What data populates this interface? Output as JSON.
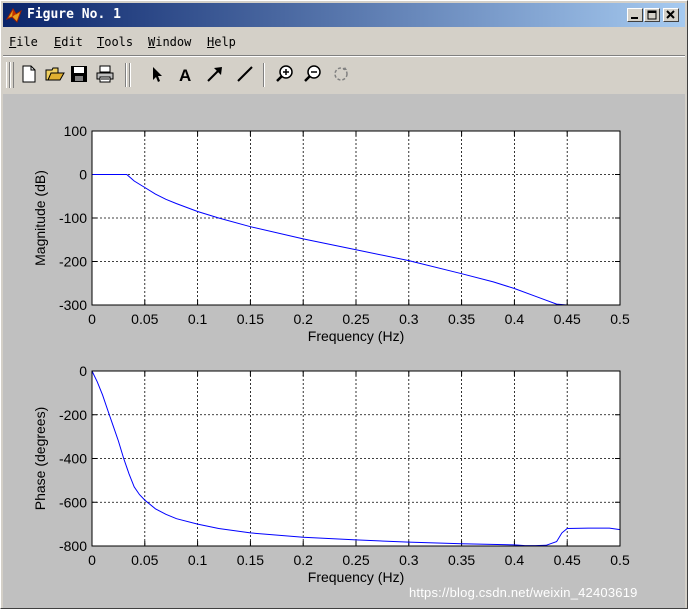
{
  "window": {
    "title": "Figure No. 1"
  },
  "menu": [
    {
      "key": "F",
      "rest": "ile"
    },
    {
      "key": "E",
      "rest": "dit"
    },
    {
      "key": "T",
      "rest": "ools"
    },
    {
      "key": "W",
      "rest": "indow"
    },
    {
      "key": "H",
      "rest": "elp"
    }
  ],
  "toolbar": {
    "icons": [
      "new-file-icon",
      "open-file-icon",
      "save-icon",
      "print-icon",
      "select-arrow-icon",
      "text-icon",
      "arrow-icon",
      "line-icon",
      "zoom-in-icon",
      "zoom-out-icon",
      "rotate-icon"
    ],
    "text_tool_label": "A"
  },
  "colors": {
    "line": "#0000ff",
    "axes_bg": "#ffffff",
    "figure_bg": "#c0c0c0",
    "titlebar_start": "#0a246a",
    "titlebar_end": "#a6caf0"
  },
  "watermark": "https://blog.csdn.net/weixin_42403619",
  "chart_data": [
    {
      "type": "line",
      "title": "",
      "xlabel": "Frequency (Hz)",
      "ylabel": "Magnitude (dB)",
      "xlim": [
        0,
        0.5
      ],
      "ylim": [
        -300,
        100
      ],
      "grid": true,
      "xticks": [
        "0",
        "0.05",
        "0.1",
        "0.15",
        "0.2",
        "0.25",
        "0.3",
        "0.35",
        "0.4",
        "0.45",
        "0.5"
      ],
      "yticks": [
        "-300",
        "-200",
        "-100",
        "0",
        "100"
      ],
      "series": [
        {
          "x": [
            0,
            0.01,
            0.02,
            0.033,
            0.04,
            0.05,
            0.06,
            0.07,
            0.08,
            0.1,
            0.12,
            0.15,
            0.2,
            0.25,
            0.3,
            0.35,
            0.38,
            0.4,
            0.42,
            0.44,
            0.45,
            0.47,
            0.5
          ],
          "y": [
            0,
            0,
            0,
            0,
            -15,
            -30,
            -45,
            -57,
            -67,
            -85,
            -100,
            -120,
            -148,
            -173,
            -198,
            -228,
            -247,
            -262,
            -280,
            -298,
            -300,
            -300,
            -300
          ]
        }
      ]
    },
    {
      "type": "line",
      "title": "",
      "xlabel": "Frequency (Hz)",
      "ylabel": "Phase (degrees)",
      "xlim": [
        0,
        0.5
      ],
      "ylim": [
        -800,
        0
      ],
      "grid": true,
      "xticks": [
        "0",
        "0.05",
        "0.1",
        "0.15",
        "0.2",
        "0.25",
        "0.3",
        "0.35",
        "0.4",
        "0.45",
        "0.5"
      ],
      "yticks": [
        "-800",
        "-600",
        "-400",
        "-200",
        "0"
      ],
      "series": [
        {
          "x": [
            0,
            0.005,
            0.01,
            0.015,
            0.02,
            0.025,
            0.03,
            0.035,
            0.04,
            0.045,
            0.05,
            0.06,
            0.07,
            0.08,
            0.1,
            0.12,
            0.15,
            0.2,
            0.25,
            0.3,
            0.35,
            0.4,
            0.41,
            0.42,
            0.43,
            0.44,
            0.445,
            0.45,
            0.47,
            0.49,
            0.5
          ],
          "y": [
            0,
            -50,
            -110,
            -180,
            -250,
            -320,
            -400,
            -470,
            -530,
            -565,
            -590,
            -630,
            -655,
            -675,
            -700,
            -720,
            -740,
            -760,
            -772,
            -782,
            -790,
            -795,
            -798,
            -798,
            -797,
            -780,
            -740,
            -720,
            -718,
            -718,
            -725
          ]
        }
      ]
    }
  ]
}
